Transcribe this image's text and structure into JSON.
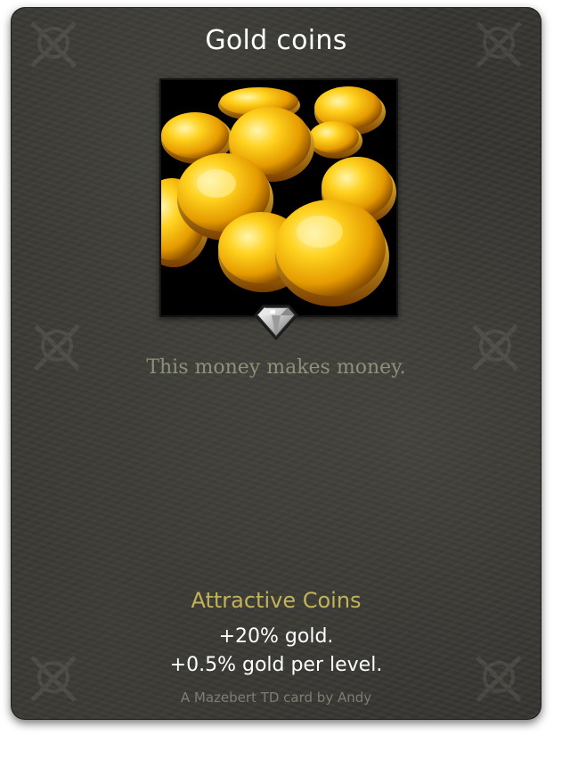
{
  "card": {
    "title": "Gold coins",
    "description": "This money makes money.",
    "rarity_icon": "diamond-rarity-icon",
    "artwork_icon": "gold-coins-artwork",
    "ability": {
      "name": "Attractive Coins",
      "line1": "+20% gold.",
      "line2": "+0.5% gold per level."
    },
    "credit": "A Mazebert TD card by Andy"
  },
  "colors": {
    "card_background": "#363531",
    "title": "#ffffff",
    "description": "#8f9078",
    "ability_name": "#c2b258",
    "ability_text": "#ffffff",
    "credit": "#7e7d72",
    "gold": "#e8b010"
  }
}
